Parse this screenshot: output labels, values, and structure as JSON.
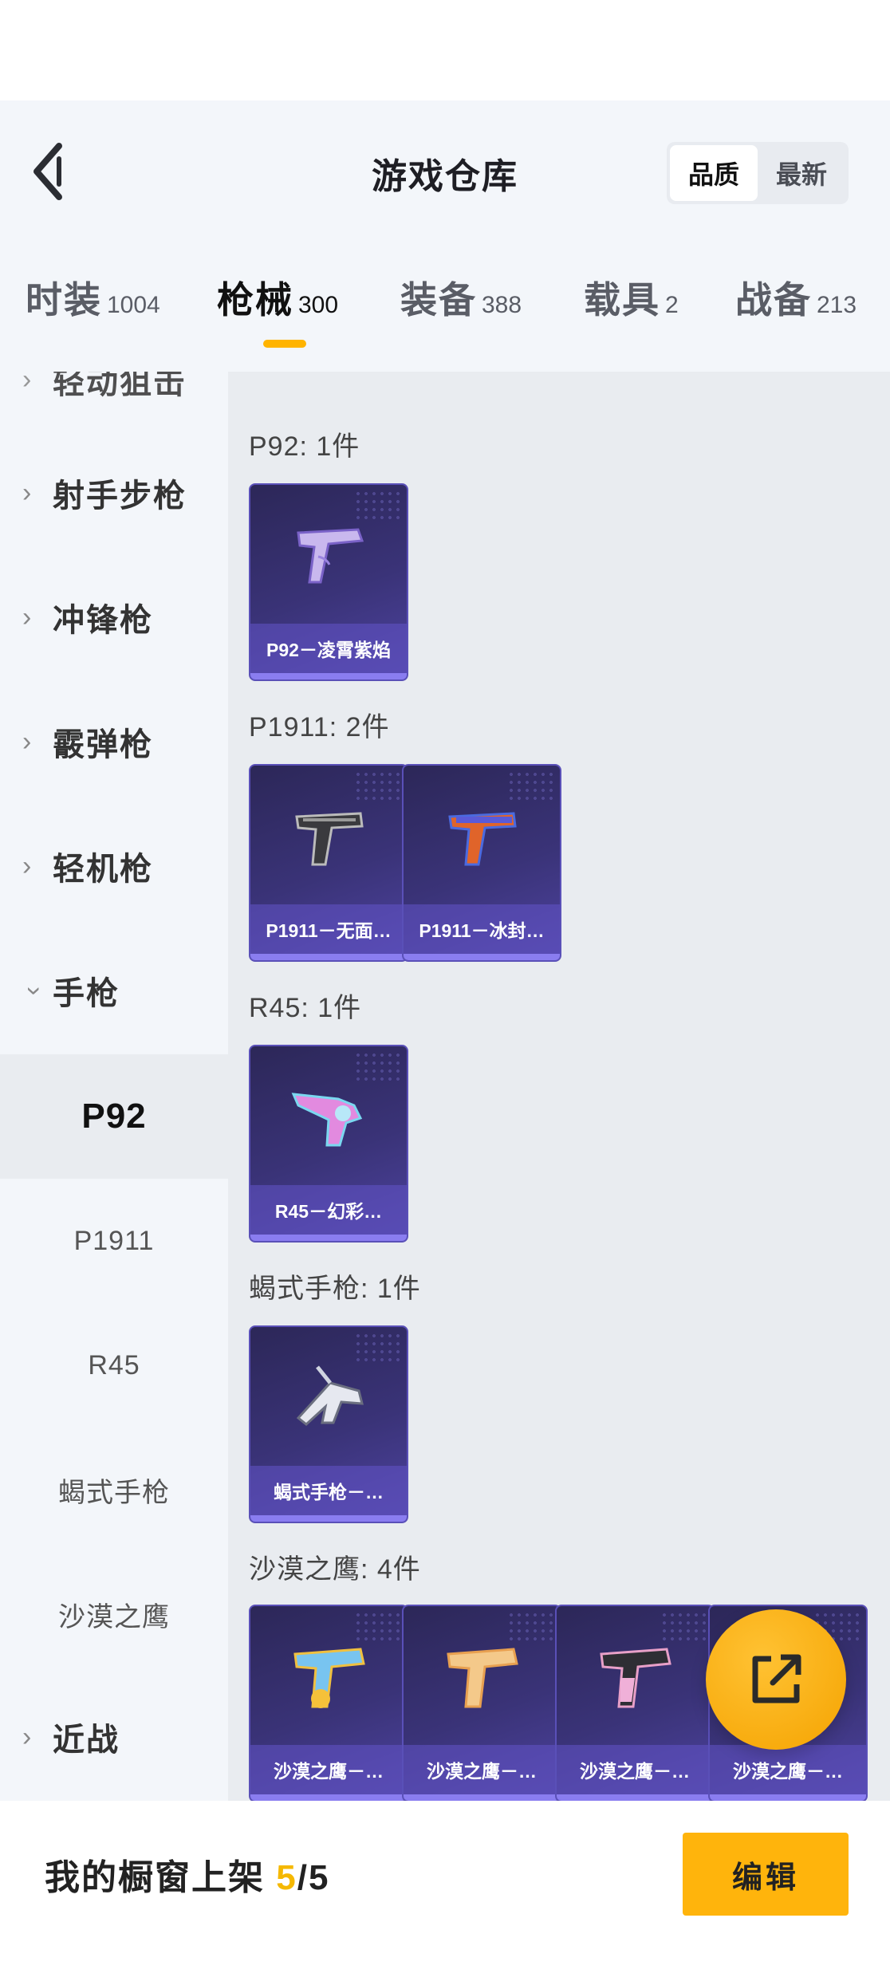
{
  "header": {
    "title": "游戏仓库",
    "sort_options": [
      {
        "label": "品质",
        "active": true
      },
      {
        "label": "最新",
        "active": false
      }
    ]
  },
  "tabs": [
    {
      "label": "时装",
      "count": "1004",
      "active": false
    },
    {
      "label": "枪械",
      "count": "300",
      "active": true
    },
    {
      "label": "装备",
      "count": "388",
      "active": false
    },
    {
      "label": "载具",
      "count": "2",
      "active": false
    },
    {
      "label": "战备",
      "count": "213",
      "active": false
    }
  ],
  "accent_color": "#ffb400",
  "sidebar": {
    "partial_top": "轻动狙击",
    "categories": [
      {
        "label": "射手步枪",
        "expanded": false
      },
      {
        "label": "冲锋枪",
        "expanded": false
      },
      {
        "label": "霰弹枪",
        "expanded": false
      },
      {
        "label": "轻机枪",
        "expanded": false
      },
      {
        "label": "手枪",
        "expanded": true
      }
    ],
    "subitems": [
      {
        "label": "P92",
        "active": true
      },
      {
        "label": "P1911",
        "active": false
      },
      {
        "label": "R45",
        "active": false
      },
      {
        "label": "蝎式手枪",
        "active": false
      },
      {
        "label": "沙漠之鹰",
        "active": false
      }
    ],
    "bottom_category": {
      "label": "近战",
      "expanded": false
    }
  },
  "groups": [
    {
      "title": "P92: 1件",
      "items": [
        "P92－凌霄紫焰"
      ]
    },
    {
      "title": "P1911: 2件",
      "items": [
        "P1911－无面…",
        "P1911－冰封…"
      ]
    },
    {
      "title": "R45: 1件",
      "items": [
        "R45－幻彩…"
      ]
    },
    {
      "title": "蝎式手枪: 1件",
      "items": [
        "蝎式手枪－…"
      ]
    },
    {
      "title": "沙漠之鹰: 4件",
      "items": [
        "沙漠之鹰－…",
        "沙漠之鹰－…",
        "沙漠之鹰－…",
        "沙漠之鹰－…"
      ]
    }
  ],
  "footer": {
    "label": "我的橱窗上架 ",
    "current": "5",
    "total": "/5",
    "edit_label": "编辑"
  },
  "icons": {
    "back": "back-chevron-icon",
    "share": "share-external-icon"
  }
}
